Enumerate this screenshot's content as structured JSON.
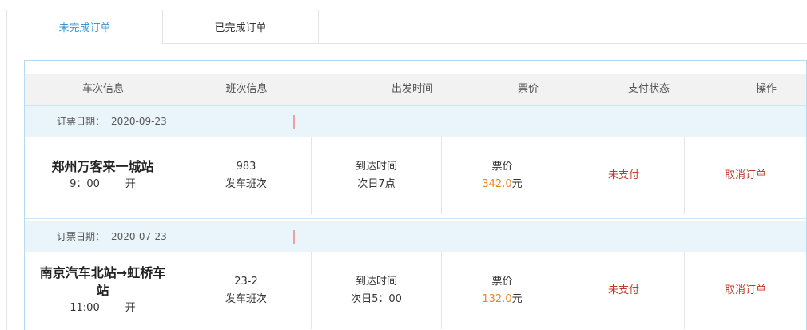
{
  "tabs": [
    {
      "label": "未完成订单"
    },
    {
      "label": "已完成订单"
    }
  ],
  "table": {
    "columns": [
      "车次信息",
      "班次信息",
      "出发时间",
      "票价",
      "支付状态",
      "操作"
    ],
    "orders": [
      {
        "date_label": "订票日期：",
        "date": "2020-09-23",
        "station": "郑州万客来一城站",
        "depart_time": "9：00",
        "depart_word": "开",
        "shift_no": "983",
        "shift_label": "发车班次",
        "arrive_label": "到达时间",
        "arrive_value": "次日7点",
        "price_label": "票价",
        "price_value": "342.0",
        "price_unit": "元",
        "pay_status": "未支付",
        "action": "取消订单"
      },
      {
        "date_label": "订票日期：",
        "date": "2020-07-23",
        "station": "南京汽车北站→虹桥车站",
        "depart_time": "11:00",
        "depart_word": "开",
        "shift_no": "23-2",
        "shift_label": "发车班次",
        "arrive_label": "到达时间",
        "arrive_value": "次日5：00",
        "price_label": "票价",
        "price_value": "132.0",
        "price_unit": "元",
        "pay_status": "未支付",
        "action": "取消订单"
      }
    ]
  },
  "colors": {
    "active_tab": "#3a94d8",
    "price": "#e8892b",
    "status": "#c0392b",
    "date_bar": "#eaf4fb"
  }
}
